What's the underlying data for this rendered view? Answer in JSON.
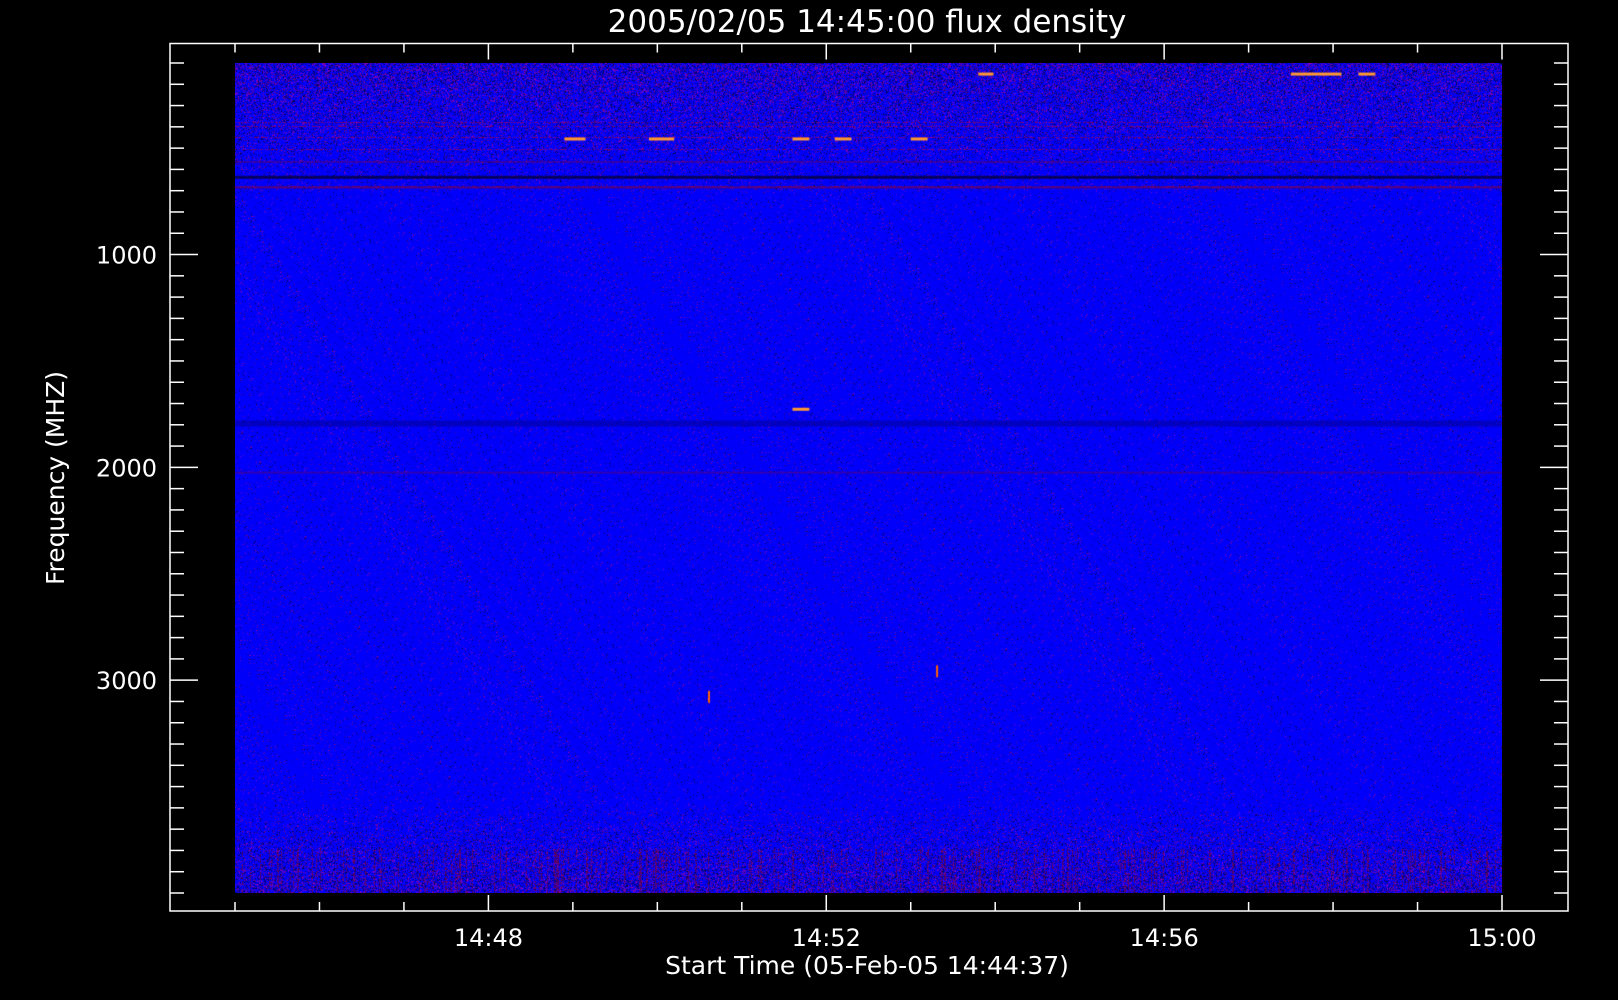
{
  "chart_data": {
    "type": "heatmap",
    "title": "2005/02/05 14:45:00 flux density",
    "xlabel": "Start Time (05-Feb-05 14:44:37)",
    "ylabel": "Frequency (MHZ)",
    "x_range_minutes": [
      "14:45",
      "15:00"
    ],
    "x_ticks": [
      {
        "label": "14:48",
        "minute": 48
      },
      {
        "label": "14:52",
        "minute": 52
      },
      {
        "label": "14:56",
        "minute": 56
      },
      {
        "label": "15:00",
        "minute": 60
      }
    ],
    "y_range_mhz": [
      100,
      4000
    ],
    "y_inverted": true,
    "y_ticks": [
      {
        "label": "1000",
        "value": 1000
      },
      {
        "label": "2000",
        "value": 2000
      },
      {
        "label": "3000",
        "value": 3000
      }
    ],
    "y_minor_step_mhz": 100,
    "x_minor_step_minutes": 1,
    "colormap": {
      "low": "#000000",
      "mid": "#0000ff",
      "high": "#ff8000"
    },
    "bright_features": [
      {
        "minute": 48.9,
        "mhz": 450,
        "width_min": 0.25
      },
      {
        "minute": 49.9,
        "mhz": 450,
        "width_min": 0.3
      },
      {
        "minute": 51.6,
        "mhz": 450,
        "width_min": 0.2
      },
      {
        "minute": 52.1,
        "mhz": 450,
        "width_min": 0.2
      },
      {
        "minute": 53.0,
        "mhz": 450,
        "width_min": 0.2
      },
      {
        "minute": 53.8,
        "mhz": 145,
        "width_min": 0.18
      },
      {
        "minute": 57.5,
        "mhz": 145,
        "width_min": 0.6
      },
      {
        "minute": 58.3,
        "mhz": 145,
        "width_min": 0.2
      },
      {
        "minute": 51.6,
        "mhz": 1720,
        "width_min": 0.2
      },
      {
        "minute": 53.3,
        "mhz": 2930,
        "width_min": 0.02
      },
      {
        "minute": 50.6,
        "mhz": 3050,
        "width_min": 0.02
      }
    ]
  }
}
